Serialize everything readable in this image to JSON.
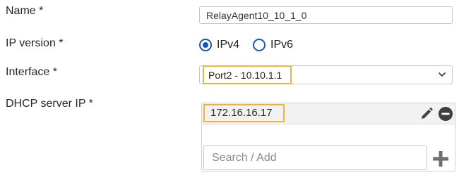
{
  "form": {
    "name_label": "Name *",
    "name_value": "RelayAgent10_10_1_0",
    "ip_version_label": "IP version *",
    "ip_version_options": [
      "IPv4",
      "IPv6"
    ],
    "ip_version_selected": "IPv4",
    "interface_label": "Interface *",
    "interface_value": "Port2 - 10.10.1.1",
    "dhcp_label": "DHCP server IP *",
    "dhcp_servers": [
      "172.16.16.17"
    ],
    "search_placeholder": "Search / Add"
  },
  "colors": {
    "accent": "#1a57b5",
    "highlight": "#f0b43c",
    "icon_dark": "#444444",
    "plus_icon": "#6f6f6f"
  },
  "icons": [
    "radio-selected-icon",
    "radio-unselected-icon",
    "chevron-down-icon",
    "pencil-icon",
    "minus-circle-icon",
    "plus-icon"
  ]
}
